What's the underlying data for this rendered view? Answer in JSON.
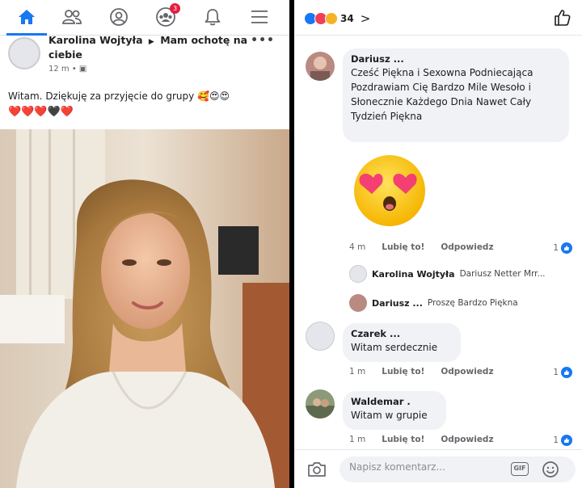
{
  "left": {
    "nav": {
      "items": [
        "home",
        "friends",
        "profile",
        "groups",
        "notifications",
        "menu"
      ],
      "groups_badge": "3"
    },
    "post": {
      "author": "Karolina Wojtyła",
      "action": "Mam ochotę na ciebie",
      "time": "12 m",
      "more": "•••",
      "text": "Witam. Dziękuję za przyjęcie do grupy",
      "text_emojis": "🥰😍😍",
      "hearts": [
        "❤️",
        "❤️",
        "❤️",
        "🖤",
        "❤️"
      ]
    }
  },
  "right": {
    "reactions": {
      "icons": [
        "like",
        "love",
        "wow"
      ],
      "count": "34",
      "chevron": ">"
    },
    "comments": [
      {
        "name": "Dariusz ...",
        "text": "Cześć Piękna i Sexowna Podniecająca Pozdrawiam Cię Bardzo Mile Wesoło i Słonecznie Każdego Dnia Nawet Cały Tydzień Piękna",
        "time": "4 m",
        "like": "Lubię to!",
        "reply": "Odpowiedz",
        "likes": "1"
      },
      {
        "name": "Czarek ...",
        "text": "Witam serdecznie",
        "time": "1 m",
        "like": "Lubię to!",
        "reply": "Odpowiedz",
        "likes": "1"
      },
      {
        "name": "Waldemar .",
        "text": "Witam w grupie",
        "time": "1 m",
        "like": "Lubię to!",
        "reply": "Odpowiedz",
        "likes": "1"
      }
    ],
    "replies": [
      {
        "name": "Karolina Wojtyła",
        "text": "Dariusz Netter Mrr..."
      },
      {
        "name": "Dariusz ...",
        "text": "Proszę Bardzo Piękna"
      }
    ],
    "composer": {
      "placeholder": "Napisz komentarz...",
      "gif": "GIF"
    }
  }
}
